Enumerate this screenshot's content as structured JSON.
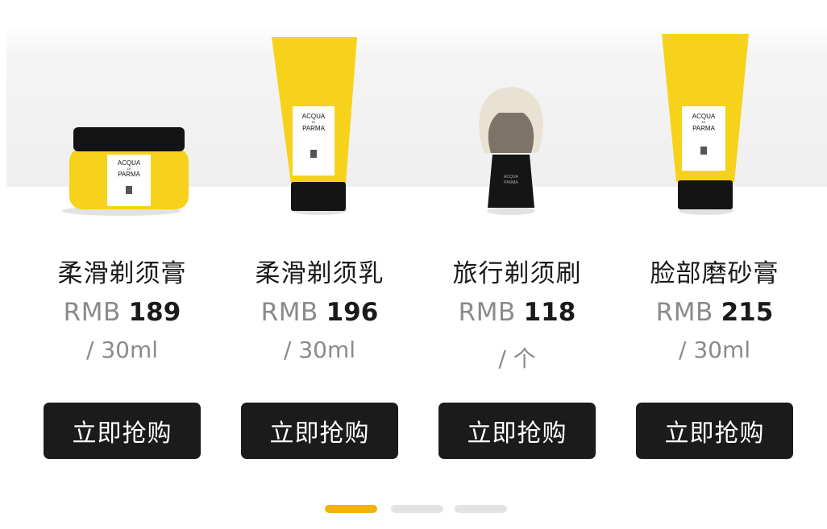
{
  "products": [
    {
      "name": "柔滑剃须膏",
      "currency": "RMB",
      "price": "189",
      "unit": "/ 30ml",
      "button": "立即抢购",
      "brand": [
        "ACQUA",
        "DI",
        "PARMA"
      ]
    },
    {
      "name": "柔滑剃须乳",
      "currency": "RMB",
      "price": "196",
      "unit": "/ 30ml",
      "button": "立即抢购",
      "brand": [
        "ACQUA",
        "DI",
        "PARMA"
      ]
    },
    {
      "name": "旅行剃须刷",
      "currency": "RMB",
      "price": "118",
      "unit": "/ 个",
      "button": "立即抢购",
      "brand": [
        "ACQUA",
        "DI",
        "PARMA"
      ]
    },
    {
      "name": "脸部磨砂膏",
      "currency": "RMB",
      "price": "215",
      "unit": "/ 30ml",
      "button": "立即抢购",
      "brand": [
        "ACQUA",
        "DI",
        "PARMA"
      ]
    }
  ],
  "carousel": {
    "active_index": 0,
    "count": 3
  },
  "colors": {
    "accent": "#f2b20c",
    "product_yellow": "#f6d21b",
    "button_bg": "#1b1b1b"
  }
}
